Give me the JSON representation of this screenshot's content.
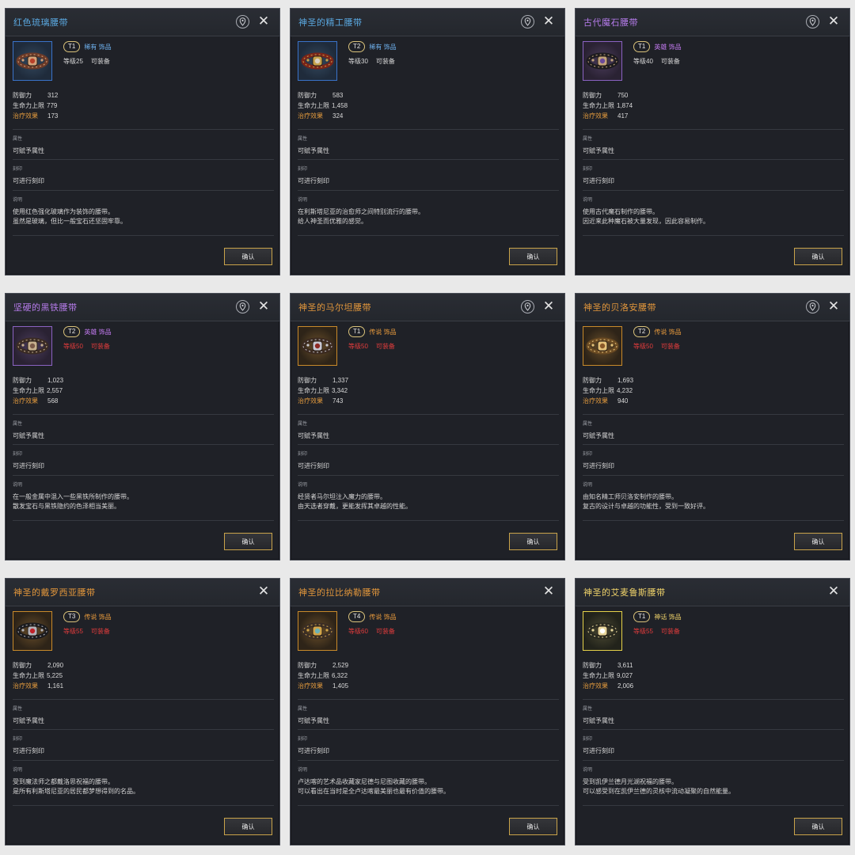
{
  "colors": {
    "blue_title": "#5aa8e0",
    "purple_title": "#b57bea",
    "orange_title": "#e2963b",
    "gold_title": "#f0d36a",
    "rare_text": "#6fb2ef",
    "heroic_text": "#c47bf2",
    "legend_text": "#e89a3c",
    "myth_text": "#f0d36a",
    "heal_label": "#e39a3d",
    "red_text": "#e23c3c",
    "white_text": "#d8d8d8"
  },
  "labels": {
    "defense": "防御力",
    "hp_max": "生命力上限",
    "heal": "治疗效果",
    "attr_title": "属性",
    "attr_value": "可赋予属性",
    "engrave_title": "刻印",
    "engrave_value": "可进行刻印",
    "desc_title": "说明",
    "confirm": "确认"
  },
  "cards": [
    {
      "title": "红色琉璃腰带",
      "title_color": "#5aa8e0",
      "has_pin": true,
      "tier": "T1",
      "rarity": "稀有 饰品",
      "rarity_color": "#6fb2ef",
      "level": "等级25",
      "equip": "可装备",
      "level_color": "#d8d8d8",
      "frame": "blue",
      "icon": "belt-red-glass-icon",
      "defense": "312",
      "hp": "779",
      "heal": "173",
      "desc1": "使用红色强化玻璃作为装饰的腰带。",
      "desc2": "虽然是玻璃，但比一般宝石还坚固牢靠。"
    },
    {
      "title": "神圣的精工腰带",
      "title_color": "#5aa8e0",
      "has_pin": true,
      "tier": "T2",
      "rarity": "稀有 饰品",
      "rarity_color": "#6fb2ef",
      "level": "等级30",
      "equip": "可装备",
      "level_color": "#d8d8d8",
      "frame": "blue",
      "icon": "belt-crafted-icon",
      "defense": "583",
      "hp": "1,458",
      "heal": "324",
      "desc1": "在利斯塔尼亚的治愈师之间特别流行的腰带。",
      "desc2": "给人神圣而优雅的感觉。"
    },
    {
      "title": "古代魔石腰带",
      "title_color": "#b57bea",
      "has_pin": true,
      "tier": "T1",
      "rarity": "英雄 饰品",
      "rarity_color": "#c47bf2",
      "level": "等级40",
      "equip": "可装备",
      "level_color": "#d8d8d8",
      "frame": "purple",
      "icon": "belt-magic-stone-icon",
      "defense": "750",
      "hp": "1,874",
      "heal": "417",
      "desc1": "使用古代魔石制作的腰带。",
      "desc2": "因近来此种魔石被大量发现，因此容易制作。"
    },
    {
      "title": "坚硬的黑铁腰带",
      "title_color": "#b57bea",
      "has_pin": true,
      "tier": "T2",
      "rarity": "英雄 饰品",
      "rarity_color": "#c47bf2",
      "level": "等级50",
      "equip": "可装备",
      "level_color": "#e23c3c",
      "frame": "purple",
      "icon": "belt-black-iron-icon",
      "defense": "1,023",
      "hp": "2,557",
      "heal": "568",
      "desc1": "在一般金属中混入一些黑铁所制作的腰带。",
      "desc2": "散发宝石与黑铁隐约的色泽相当美丽。"
    },
    {
      "title": "神圣的马尔坦腰带",
      "title_color": "#e2963b",
      "has_pin": true,
      "tier": "T1",
      "rarity": "传说 饰品",
      "rarity_color": "#e89a3c",
      "level": "等级50",
      "equip": "可装备",
      "level_color": "#e23c3c",
      "frame": "orange",
      "icon": "belt-martan-icon",
      "defense": "1,337",
      "hp": "3,342",
      "heal": "743",
      "desc1": "经贤者马尔坦注入魔力的腰带。",
      "desc2": "由天选者穿戴，更能发挥其卓越的性能。"
    },
    {
      "title": "神圣的贝洛安腰带",
      "title_color": "#e2963b",
      "has_pin": true,
      "tier": "T2",
      "rarity": "传说 饰品",
      "rarity_color": "#e89a3c",
      "level": "等级50",
      "equip": "可装备",
      "level_color": "#e23c3c",
      "frame": "orange",
      "icon": "belt-beloan-icon",
      "defense": "1,693",
      "hp": "4,232",
      "heal": "940",
      "desc1": "由知名精工师贝洛安制作的腰带。",
      "desc2": "复古的设计与卓越的功能性，受到一致好评。"
    },
    {
      "title": "神圣的戴罗西亚腰带",
      "title_color": "#e2963b",
      "has_pin": false,
      "tier": "T3",
      "rarity": "传说 饰品",
      "rarity_color": "#e89a3c",
      "level": "等级55",
      "equip": "可装备",
      "level_color": "#e23c3c",
      "frame": "orange",
      "icon": "belt-derosia-icon",
      "defense": "2,090",
      "hp": "5,225",
      "heal": "1,161",
      "desc1": "受到魔法师之都戴洛思祝福的腰带。",
      "desc2": "是所有利斯塔尼亚的居民都梦想得到的名品。"
    },
    {
      "title": "神圣的拉比纳勒腰带",
      "title_color": "#e2963b",
      "has_pin": false,
      "tier": "T4",
      "rarity": "传说 饰品",
      "rarity_color": "#e89a3c",
      "level": "等级60",
      "equip": "可装备",
      "level_color": "#e23c3c",
      "frame": "orange",
      "icon": "belt-rabinale-icon",
      "defense": "2,529",
      "hp": "6,322",
      "heal": "1,405",
      "desc1": "卢达喀的艺术品收藏家尼德与尼图收藏的腰带。",
      "desc2": "可以看出在当时是全卢达喀最美丽也最有价值的腰带。"
    },
    {
      "title": "神圣的艾麦鲁斯腰带",
      "title_color": "#f0d36a",
      "has_pin": false,
      "tier": "T1",
      "rarity": "神话 饰品",
      "rarity_color": "#f0d36a",
      "level": "等级55",
      "equip": "可装备",
      "level_color": "#e23c3c",
      "frame": "gold",
      "icon": "belt-emerus-icon",
      "defense": "3,611",
      "hp": "9,027",
      "heal": "2,006",
      "desc1": "受到凯伊兰德月光湖祝福的腰带。",
      "desc2": "可以感受到在凯伊兰德的灵核中流动凝聚的自然能量。"
    }
  ]
}
